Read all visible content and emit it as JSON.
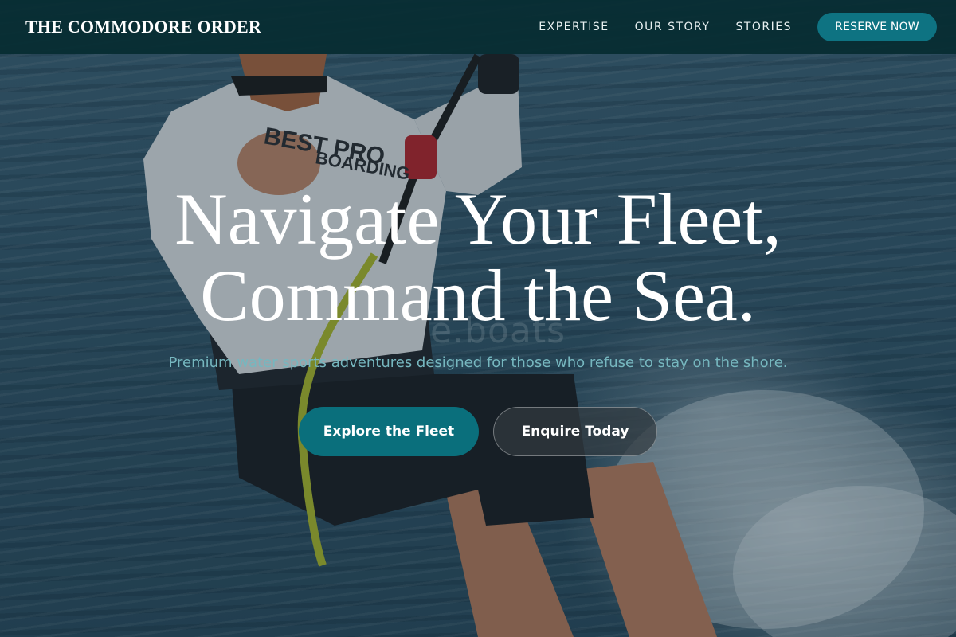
{
  "nav": {
    "brand": "THE COMMODORE ORDER",
    "links": [
      "EXPERTISE",
      "OUR STORY",
      "STORIES"
    ],
    "reserve_label": "RESERVE NOW"
  },
  "hero": {
    "headline_line1": "Navigate Your Fleet,",
    "headline_line2": "Command the Sea.",
    "watermark": "e.boats",
    "subheadline": "Premium water sports adventures designed for those who refuse to stay on the shore.",
    "primary_cta": "Explore the Fleet",
    "secondary_cta": "Enquire Today"
  },
  "image": {
    "subject": "kiteboarder-photo",
    "shirt_text_line1": "BEST PRO",
    "shirt_text_line2": "BOARDING"
  },
  "colors": {
    "nav_bg": "#062c32",
    "accent_teal": "#0e7382",
    "subhead_teal": "#76b7bf",
    "text_white": "#ffffff"
  }
}
